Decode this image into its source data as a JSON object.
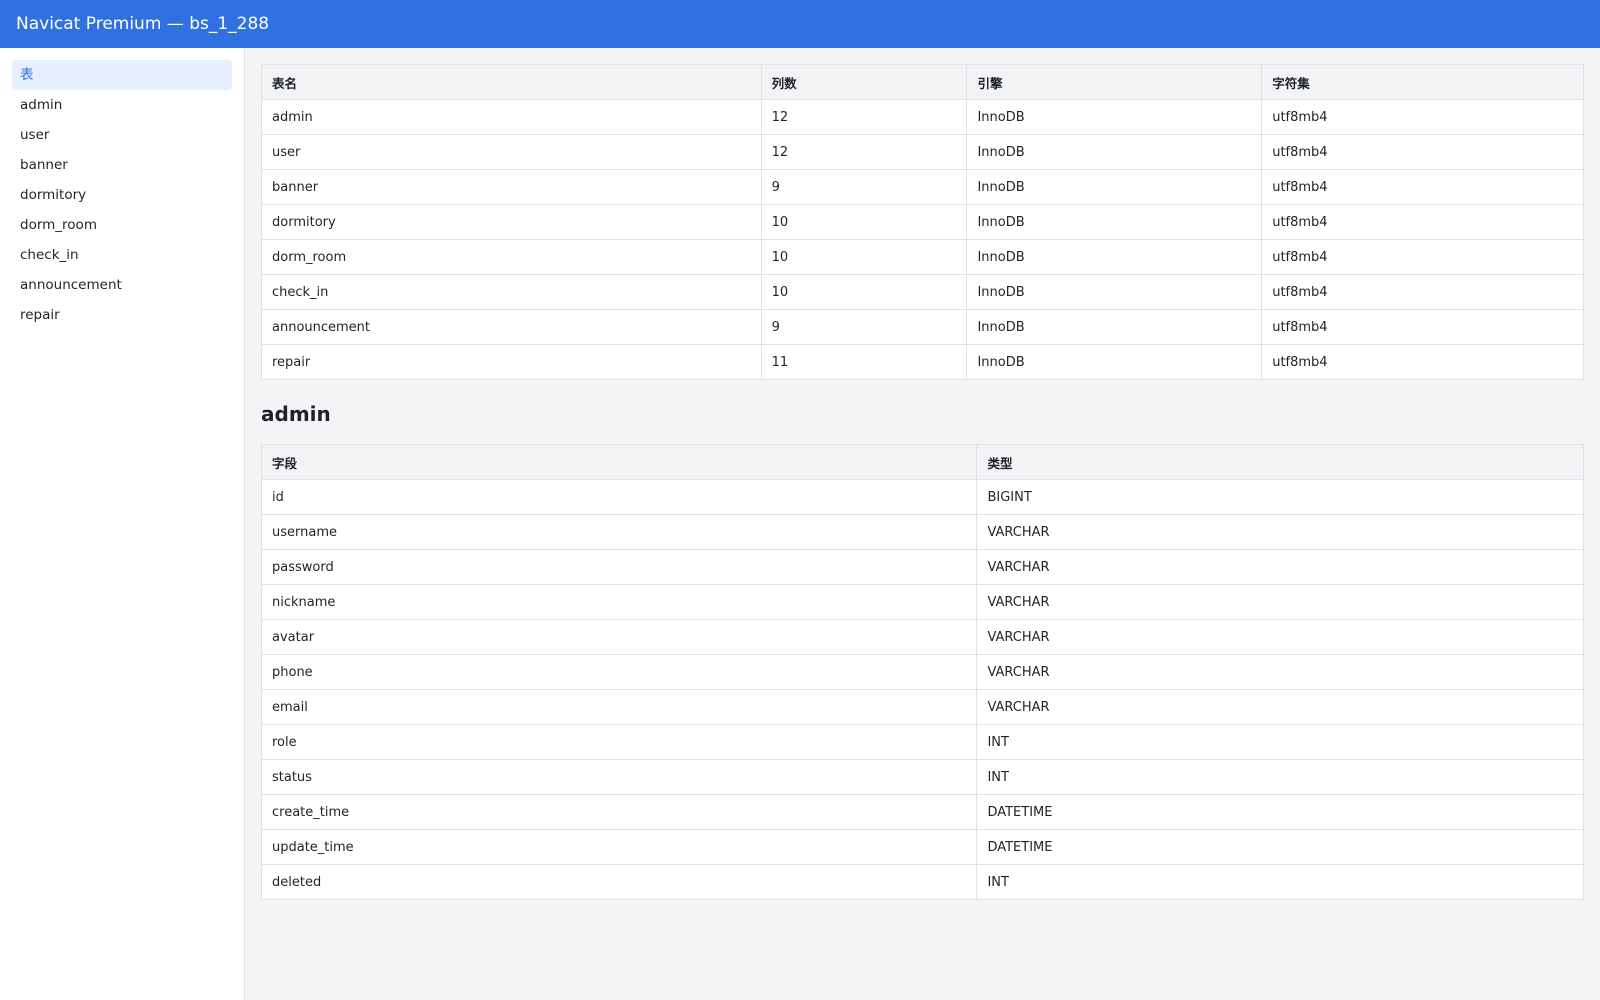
{
  "window": {
    "title": "Navicat Premium — bs_1_288"
  },
  "sidebar": {
    "items": [
      {
        "label": "表"
      },
      {
        "label": "admin"
      },
      {
        "label": "user"
      },
      {
        "label": "banner"
      },
      {
        "label": "dormitory"
      },
      {
        "label": "dorm_room"
      },
      {
        "label": "check_in"
      },
      {
        "label": "announcement"
      },
      {
        "label": "repair"
      }
    ]
  },
  "tables_overview": {
    "headers": {
      "name": "表名",
      "columns": "列数",
      "engine": "引擎",
      "charset": "字符集"
    },
    "rows": [
      {
        "name": "admin",
        "columns": "12",
        "engine": "InnoDB",
        "charset": "utf8mb4"
      },
      {
        "name": "user",
        "columns": "12",
        "engine": "InnoDB",
        "charset": "utf8mb4"
      },
      {
        "name": "banner",
        "columns": "9",
        "engine": "InnoDB",
        "charset": "utf8mb4"
      },
      {
        "name": "dormitory",
        "columns": "10",
        "engine": "InnoDB",
        "charset": "utf8mb4"
      },
      {
        "name": "dorm_room",
        "columns": "10",
        "engine": "InnoDB",
        "charset": "utf8mb4"
      },
      {
        "name": "check_in",
        "columns": "10",
        "engine": "InnoDB",
        "charset": "utf8mb4"
      },
      {
        "name": "announcement",
        "columns": "9",
        "engine": "InnoDB",
        "charset": "utf8mb4"
      },
      {
        "name": "repair",
        "columns": "11",
        "engine": "InnoDB",
        "charset": "utf8mb4"
      }
    ]
  },
  "detail": {
    "title": "admin",
    "headers": {
      "field": "字段",
      "type": "类型"
    },
    "rows": [
      {
        "field": "id",
        "type": "BIGINT"
      },
      {
        "field": "username",
        "type": "VARCHAR"
      },
      {
        "field": "password",
        "type": "VARCHAR"
      },
      {
        "field": "nickname",
        "type": "VARCHAR"
      },
      {
        "field": "avatar",
        "type": "VARCHAR"
      },
      {
        "field": "phone",
        "type": "VARCHAR"
      },
      {
        "field": "email",
        "type": "VARCHAR"
      },
      {
        "field": "role",
        "type": "INT"
      },
      {
        "field": "status",
        "type": "INT"
      },
      {
        "field": "create_time",
        "type": "DATETIME"
      },
      {
        "field": "update_time",
        "type": "DATETIME"
      },
      {
        "field": "deleted",
        "type": "INT"
      }
    ]
  },
  "colors": {
    "accent": "#3070e0",
    "active_bg": "#e6effd"
  }
}
